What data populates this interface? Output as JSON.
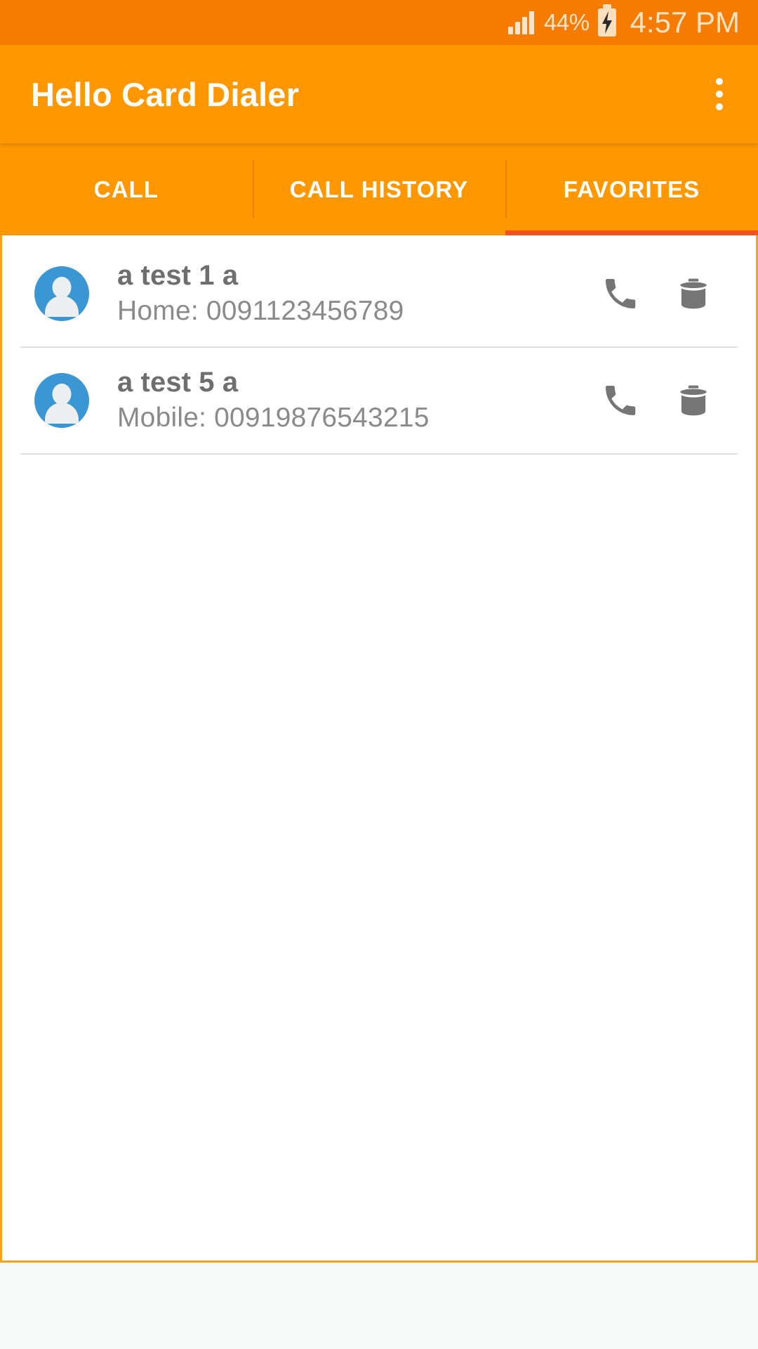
{
  "statusbar": {
    "signal_icon": "signal-bars-icon",
    "battery_percent": "44%",
    "battery_icon": "battery-charging-icon",
    "time": "4:57 PM"
  },
  "appbar": {
    "title": "Hello Card Dialer",
    "overflow_icon": "overflow-menu-icon"
  },
  "tabs": [
    {
      "label": "CALL",
      "active": false
    },
    {
      "label": "CALL HISTORY",
      "active": false
    },
    {
      "label": "FAVORITES",
      "active": true
    }
  ],
  "favorites": [
    {
      "name": "a test 1 a",
      "detail": "Home: 0091123456789",
      "avatar_icon": "person-avatar-icon",
      "call_icon": "phone-icon",
      "delete_icon": "trash-icon"
    },
    {
      "name": "a test 5 a",
      "detail": "Mobile: 00919876543215",
      "avatar_icon": "person-avatar-icon",
      "call_icon": "phone-icon",
      "delete_icon": "trash-icon"
    }
  ],
  "colors": {
    "status_bar": "#F57C00",
    "app_bar": "#FF9800",
    "tab_indicator": "#F4511E",
    "content_border": "#F5A21E",
    "avatar_blue": "#3B97D3",
    "icon_gray": "#757575",
    "primary_text": "#6E6E6E",
    "secondary_text": "#8A8A8A"
  }
}
